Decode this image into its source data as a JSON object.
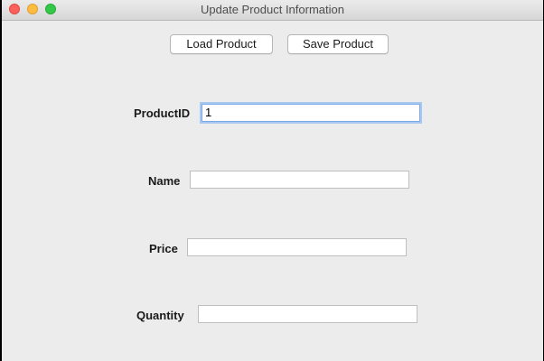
{
  "window": {
    "title": "Update Product Information"
  },
  "toolbar": {
    "load_label": "Load Product",
    "save_label": "Save Product"
  },
  "form": {
    "product_id": {
      "label": "ProductID",
      "value": "1"
    },
    "name": {
      "label": "Name",
      "value": ""
    },
    "price": {
      "label": "Price",
      "value": ""
    },
    "quantity": {
      "label": "Quantity",
      "value": ""
    }
  },
  "colors": {
    "window_bg": "#ececec",
    "focus_ring": "#7aa9e6",
    "close": "#fc605c",
    "minimize": "#fdbc40",
    "zoom": "#34c84a"
  }
}
